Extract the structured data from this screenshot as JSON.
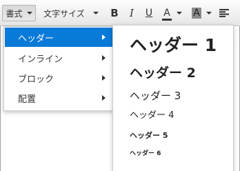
{
  "toolbar": {
    "format_label": "書式",
    "fontsize_label": "文字サイズ",
    "bold_label": "B",
    "italic_label": "I",
    "underline_label": "U",
    "forecolor_label": "A",
    "backcolor_label": "A"
  },
  "format_menu": {
    "items": [
      {
        "label": "ヘッダー",
        "active": true
      },
      {
        "label": "インライン"
      },
      {
        "label": "ブロック"
      },
      {
        "label": "配置"
      }
    ]
  },
  "header_submenu": {
    "items": [
      {
        "label": "ヘッダー 1"
      },
      {
        "label": "ヘッダー 2"
      },
      {
        "label": "ヘッダー 3"
      },
      {
        "label": "ヘッダー 4"
      },
      {
        "label": "ヘッダー 5"
      },
      {
        "label": "ヘッダー 6"
      }
    ]
  },
  "colors": {
    "menu_highlight": "#0a7ad8",
    "menu_highlight_text": "#ffffff"
  }
}
